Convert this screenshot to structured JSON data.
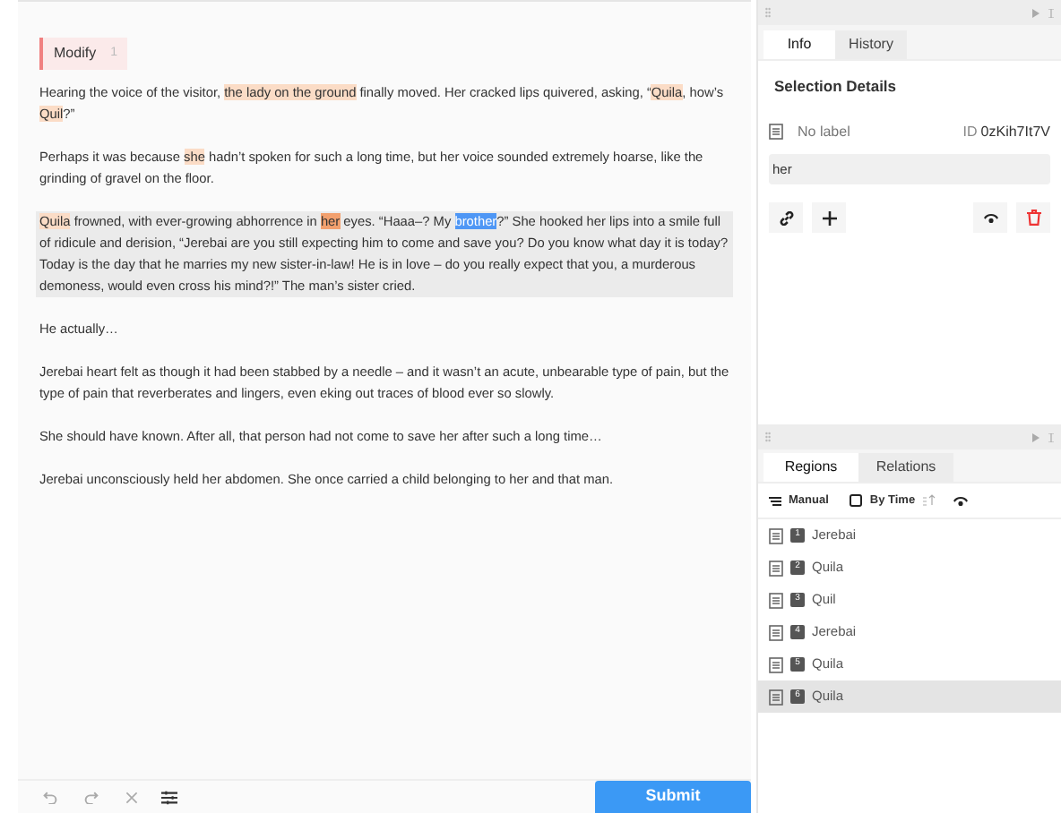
{
  "editor": {
    "tag": {
      "label": "Modify",
      "count": "1"
    },
    "paragraphs": [
      {
        "selected": false,
        "segments": [
          {
            "kind": "plain",
            "text": "Hearing the voice of the visitor, "
          },
          {
            "kind": "region",
            "text": "the lady on the ground"
          },
          {
            "kind": "plain",
            "text": " finally moved. Her cracked lips quivered, asking, “"
          },
          {
            "kind": "region",
            "text": "Quila"
          },
          {
            "kind": "plain",
            "text": ", how’s "
          },
          {
            "kind": "region",
            "text": "Quil"
          },
          {
            "kind": "plain",
            "text": "?”"
          }
        ]
      },
      {
        "selected": false,
        "segments": [
          {
            "kind": "plain",
            "text": "Perhaps it was because "
          },
          {
            "kind": "region",
            "text": "she"
          },
          {
            "kind": "plain",
            "text": " hadn’t spoken for such a long time, but her voice sounded extremely hoarse, like the grinding of gravel on the floor."
          }
        ]
      },
      {
        "selected": true,
        "segments": [
          {
            "kind": "region",
            "text": "Quila"
          },
          {
            "kind": "plain",
            "text": " frowned, with ever-growing abhorrence in "
          },
          {
            "kind": "active",
            "text": "her"
          },
          {
            "kind": "plain",
            "text": " eyes. “Haaa–? My "
          },
          {
            "kind": "selection",
            "text": "brother"
          },
          {
            "kind": "plain",
            "text": "?” She hooked her lips into a smile full of ridicule and derision, “Jerebai are you still expecting him to come and save you? Do you know what day it is today? Today is the day that he marries my new sister-in-law! He is in love – do you really expect that you, a murderous demoness, would even cross his mind?!” The man’s sister cried."
          }
        ]
      },
      {
        "selected": false,
        "segments": [
          {
            "kind": "plain",
            "text": "He actually…"
          }
        ]
      },
      {
        "selected": false,
        "segments": [
          {
            "kind": "plain",
            "text": "Jerebai heart felt as though it had been stabbed by a needle – and it wasn’t an acute, unbearable type of pain, but the type of pain that reverberates and lingers, even eking out traces of blood ever so slowly."
          }
        ]
      },
      {
        "selected": false,
        "segments": [
          {
            "kind": "plain",
            "text": "She should have known. After all, that person had not come to save her after such a long time…"
          }
        ]
      },
      {
        "selected": false,
        "segments": [
          {
            "kind": "plain",
            "text": "Jerebai unconsciously held her abdomen. She once carried a child belonging to her and that man."
          }
        ]
      }
    ],
    "submit": "Submit"
  },
  "info_panel": {
    "tabs": [
      {
        "label": "Info",
        "selected": true
      },
      {
        "label": "History",
        "selected": false
      }
    ],
    "title": "Selection Details",
    "label": "No label",
    "id_prefix": "ID",
    "id": "0zKih7It7V",
    "text": "her"
  },
  "regions_panel": {
    "tabs": [
      {
        "label": "Regions",
        "selected": true
      },
      {
        "label": "Relations",
        "selected": false
      }
    ],
    "sort": {
      "manual": "Manual",
      "by_time": "By Time"
    },
    "regions": [
      {
        "number": "1",
        "label": "Jerebai",
        "selected": false
      },
      {
        "number": "2",
        "label": "Quila",
        "selected": false
      },
      {
        "number": "3",
        "label": "Quil",
        "selected": false
      },
      {
        "number": "4",
        "label": "Jerebai",
        "selected": false
      },
      {
        "number": "5",
        "label": "Quila",
        "selected": false
      },
      {
        "number": "6",
        "label": "Quila",
        "selected": true
      }
    ]
  }
}
